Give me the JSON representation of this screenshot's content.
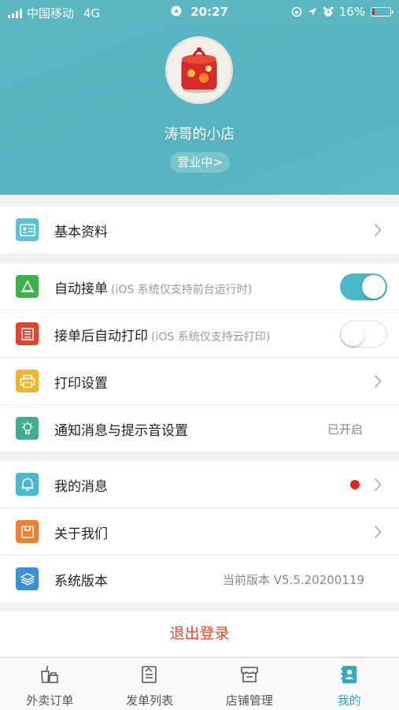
{
  "status_bar": {
    "carrier": "中国移动",
    "network": "4G",
    "time": "20:27",
    "battery": "16%",
    "battery_level": 0.16
  },
  "header": {
    "shop_name": "涛哥的小店",
    "status_pill": "营业中>"
  },
  "groups": [
    {
      "rows": [
        {
          "label": "基本资料",
          "icon": "id-card-icon",
          "icon_color": "#5bc2d4",
          "chevron": true
        }
      ]
    },
    {
      "rows": [
        {
          "label": "自动接单",
          "note": "(iOS 系统仅支持前台运行时)",
          "icon": "order-bell-icon",
          "icon_color": "#39b34a",
          "toggle": true
        },
        {
          "label": "接单后自动打印",
          "note": "(iOS 系统仅支持云打印)",
          "icon": "receipt-print-icon",
          "icon_color": "#e8412b",
          "toggle": false
        },
        {
          "label": "打印设置",
          "icon": "printer-icon",
          "icon_color": "#f2b52a",
          "chevron": true
        },
        {
          "label": "通知消息与提示音设置",
          "icon": "lightbulb-icon",
          "icon_color": "#3fae90",
          "value": "已开启"
        }
      ]
    },
    {
      "rows": [
        {
          "label": "我的消息",
          "icon": "bell-icon",
          "icon_color": "#4bb8d0",
          "chevron": true,
          "unread_dot": true
        },
        {
          "label": "关于我们",
          "icon": "info-box-icon",
          "icon_color": "#ef8033",
          "chevron": true
        },
        {
          "label": "系统版本",
          "icon": "layers-icon",
          "icon_color": "#3a8fdf",
          "value": "当前版本 V5.5.20200119"
        }
      ]
    }
  ],
  "logout_label": "退出登录",
  "tabs": [
    {
      "label": "外卖订单",
      "icon": "takeout-cup-icon",
      "active": false
    },
    {
      "label": "发单列表",
      "icon": "order-list-icon",
      "active": false
    },
    {
      "label": "店铺管理",
      "icon": "store-icon",
      "active": false
    },
    {
      "label": "我的",
      "icon": "profile-card-icon",
      "active": true
    }
  ],
  "colors": {
    "header": "#5ab7c2",
    "accent": "#35a7c0",
    "logout": "#e5482a",
    "toggle_on": "#4bb7c9",
    "unread_dot": "#e4221b"
  }
}
